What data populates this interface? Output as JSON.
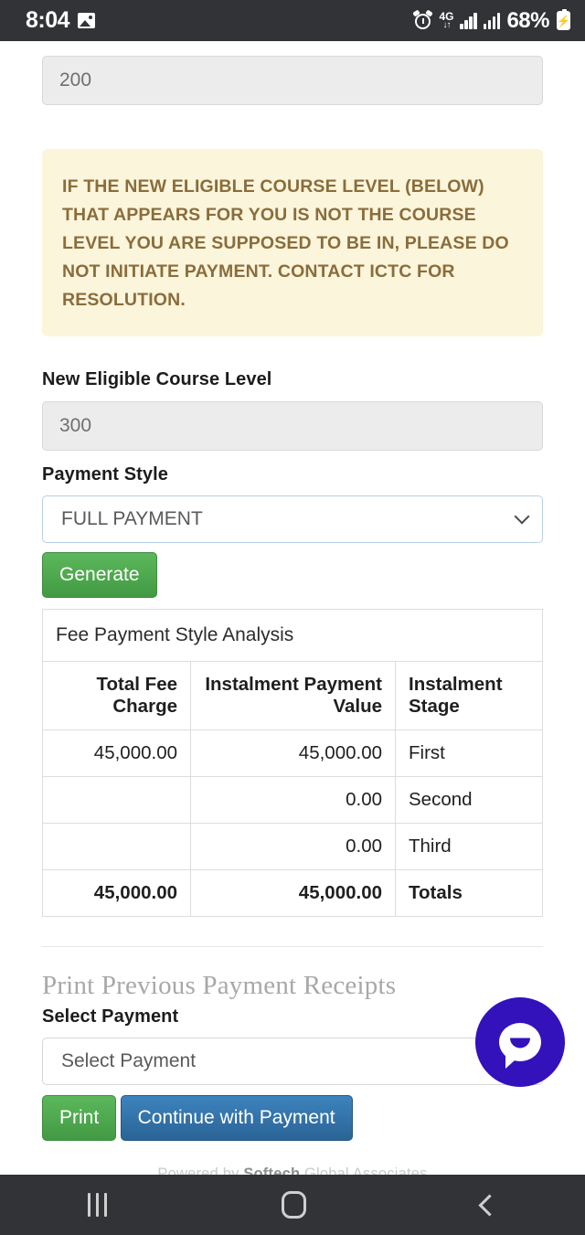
{
  "status_bar": {
    "time": "8:04",
    "image_icon": "image-icon",
    "alarm_icon": "alarm-icon",
    "network_type": "4G",
    "network_arrows": "↓↑",
    "signal_icon_1": "signal-bars-icon",
    "signal_icon_2": "signal-bars-icon",
    "battery_percent": "68%",
    "battery_icon": "battery-charging-icon"
  },
  "form": {
    "current_level_value": "200",
    "warning_text": "IF THE NEW ELIGIBLE COURSE LEVEL (BELOW) THAT APPEARS FOR YOU IS NOT THE COURSE LEVEL YOU ARE SUPPOSED TO BE IN, PLEASE DO NOT INITIATE PAYMENT. CONTACT ICTC FOR RESOLUTION.",
    "new_level_label": "New Eligible Course Level",
    "new_level_value": "300",
    "payment_style_label": "Payment Style",
    "payment_style_value": "FULL PAYMENT",
    "generate_button": "Generate"
  },
  "fee_table": {
    "caption": "Fee Payment Style Analysis",
    "headers": [
      "Total Fee Charge",
      "Instalment Payment Value",
      "Instalment Stage"
    ],
    "rows": [
      {
        "total_fee": "45,000.00",
        "instalment_value": "45,000.00",
        "stage": "First"
      },
      {
        "total_fee": "",
        "instalment_value": "0.00",
        "stage": "Second"
      },
      {
        "total_fee": "",
        "instalment_value": "0.00",
        "stage": "Third"
      }
    ],
    "totals": {
      "total_fee": "45,000.00",
      "instalment_value": "45,000.00",
      "stage": "Totals"
    }
  },
  "receipts": {
    "heading": "Print Previous Payment Receipts",
    "select_label": "Select Payment",
    "select_value": "Select Payment",
    "print_button": "Print",
    "continue_button": "Continue with Payment"
  },
  "footer": {
    "prefix": "Powered by ",
    "brand": "Softech",
    "suffix": " Global Associates"
  },
  "chat": {
    "icon": "chat-bubble-icon"
  },
  "nav_bar": {
    "recents": "recents-icon",
    "home": "home-icon",
    "back": "back-icon"
  },
  "colors": {
    "accent_green": "#5cb85c",
    "accent_blue": "#2a6496",
    "warning_bg": "#fbf5dc",
    "warning_text": "#8a6d3b",
    "chat_fab": "#3311bb",
    "system_bar": "#313336"
  }
}
